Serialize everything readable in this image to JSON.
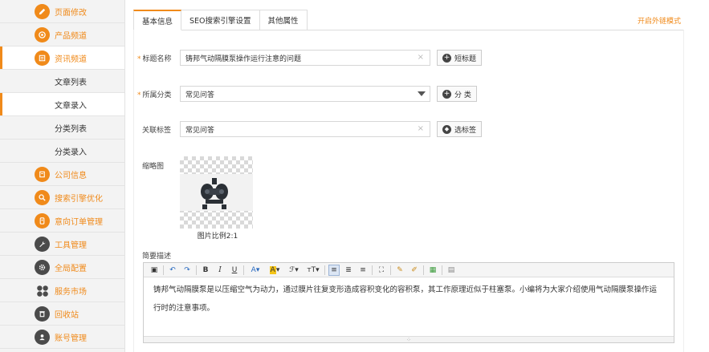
{
  "sidebar": {
    "items": [
      {
        "label": "页面修改",
        "icon": "pencil-icon",
        "top": 0,
        "type": "main"
      },
      {
        "label": "产品频道",
        "icon": "target-icon",
        "type": "main"
      },
      {
        "label": "资讯频道",
        "icon": "news-icon",
        "type": "main"
      },
      {
        "label": "文章列表",
        "type": "sub"
      },
      {
        "label": "文章录入",
        "type": "sub"
      },
      {
        "label": "分类列表",
        "type": "sub"
      },
      {
        "label": "分类录入",
        "type": "sub"
      },
      {
        "label": "公司信息",
        "icon": "list-icon",
        "type": "main"
      },
      {
        "label": "搜索引擎优化",
        "icon": "search-icon",
        "type": "main"
      },
      {
        "label": "意向订单管理",
        "icon": "order-icon",
        "type": "main"
      },
      {
        "label": "工具管理",
        "icon": "wrench-icon",
        "type": "main"
      },
      {
        "label": "全局配置",
        "icon": "gear-icon",
        "type": "main"
      },
      {
        "label": "服务市场",
        "icon": "grid-icon",
        "type": "main"
      },
      {
        "label": "回收站",
        "icon": "trash-icon",
        "type": "main"
      },
      {
        "label": "账号管理",
        "icon": "user-icon",
        "type": "main"
      }
    ]
  },
  "tabs": [
    "基本信息",
    "SEO搜索引擎设置",
    "其他属性"
  ],
  "outer_link": "开启外链模式",
  "form": {
    "title_label": "标题名称",
    "title_value": "铸邦气动隔膜泵操作运行注意的问题",
    "title_button": "短标题",
    "category_label": "所属分类",
    "category_value": "常见问答",
    "category_button": "分  类",
    "tags_label": "关联标签",
    "tags_value": "常见问答",
    "tags_button": "选标签",
    "thumb_label": "缩略图",
    "thumb_caption": "图片比例2:1",
    "desc_label": "简要描述",
    "desc_text": "铸邦气动隔膜泵是以压缩空气为动力，通过膜片往复变形造成容积变化的容积泵，其工作原理近似于柱塞泵。小编将为大家介绍使用气动隔膜泵操作运行时的注意事项。"
  },
  "colors": {
    "accent": "#f08a1a",
    "dark_icon": "#4b4b4b"
  }
}
